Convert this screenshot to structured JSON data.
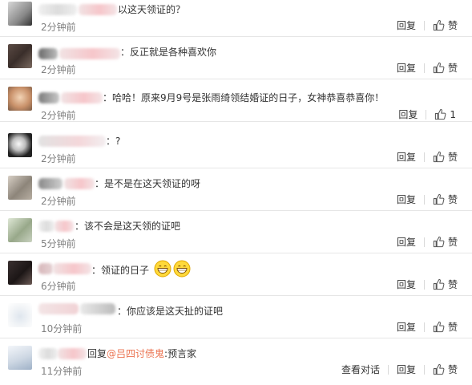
{
  "comments": [
    {
      "text": "以这天领证的？",
      "time": "2分钟前",
      "reply": "回复",
      "like": "赞"
    },
    {
      "text": "：反正就是各种喜欢你",
      "time": "2分钟前",
      "reply": "回复",
      "like": "赞"
    },
    {
      "text": "：哈哈！原来9月9号是张雨绮领结婚证的日子，女神恭喜恭喜你！",
      "time": "2分钟前",
      "reply": "回复",
      "like": "1"
    },
    {
      "text": "：?",
      "time": "2分钟前",
      "reply": "回复",
      "like": "赞"
    },
    {
      "text": "：是不是在这天领证的呀",
      "time": "2分钟前",
      "reply": "回复",
      "like": "赞"
    },
    {
      "text": "：该不会是这天领的证吧",
      "time": "5分钟前",
      "reply": "回复",
      "like": "赞"
    },
    {
      "text": "：领证的日子",
      "time": "6分钟前",
      "reply": "回复",
      "like": "赞"
    },
    {
      "text": "：你应该是这天扯的证吧",
      "time": "10分钟前",
      "reply": "回复",
      "like": "赞"
    },
    {
      "text_prefix": "回复",
      "mention": "@吕四讨债鬼",
      "text_suffix": ":预言家",
      "time": "11分钟前",
      "view_conversation": "查看对话",
      "reply": "回复",
      "like": "赞"
    }
  ],
  "colors": {
    "mention": "#eb7350",
    "time": "#808080",
    "divider": "#e6e6e6"
  },
  "icons": {
    "like": "thumbs-up-icon",
    "emoji": "grinning-face-icon"
  }
}
